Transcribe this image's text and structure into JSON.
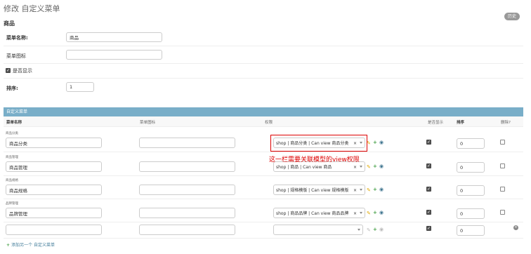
{
  "page": {
    "title": "修改 自定义菜单",
    "history_label": "历史"
  },
  "section": {
    "title": "商品"
  },
  "form": {
    "menu_name": {
      "label": "菜单名称:",
      "value": "商品"
    },
    "menu_icon": {
      "label": "菜单图标",
      "value": ""
    },
    "is_display": {
      "label": "是否显示",
      "checked": true
    },
    "sort": {
      "label": "排序:",
      "value": "1"
    }
  },
  "inline": {
    "header": "自定义菜单",
    "columns": [
      "菜单名称",
      "菜单图标",
      "权限",
      "是否显示",
      "排序",
      "删除?"
    ],
    "rows": [
      {
        "row_label": "商品分类",
        "name": "商品分类",
        "icon": "",
        "permission": "shop | 商品分类 | Can view 商品分类",
        "displayed": true,
        "sort": "0",
        "delete": false
      },
      {
        "row_label": "商品管理",
        "name": "商品管理",
        "icon": "",
        "permission": "shop | 商品 | Can view 商品",
        "displayed": true,
        "sort": "0",
        "delete": false
      },
      {
        "row_label": "商品规格",
        "name": "商品规格",
        "icon": "",
        "permission": "shop | 规格模版 | Can view 规格模版",
        "displayed": true,
        "sort": "0",
        "delete": false
      },
      {
        "row_label": "品牌管理",
        "name": "品牌管理",
        "icon": "",
        "permission": "shop | 商品品牌 | Can view 商品品牌",
        "displayed": true,
        "sort": "0",
        "delete": false
      },
      {
        "row_label": "",
        "name": "",
        "icon": "",
        "permission": "",
        "displayed": true,
        "sort": "0",
        "delete": false
      }
    ],
    "add_another": "添加另一个 自定义菜单"
  },
  "annotation": {
    "text": "这一栏需要关联模型的view权限",
    "color": "#dd0000"
  },
  "icons": {
    "edit": "pencil-icon",
    "add": "plus-icon",
    "view": "eye-icon",
    "clear": "x-icon",
    "delete": "close-circle-icon"
  },
  "colors": {
    "inline_header_bg": "#79aec8",
    "history_button_bg": "#999999",
    "link": "#447e9b"
  }
}
